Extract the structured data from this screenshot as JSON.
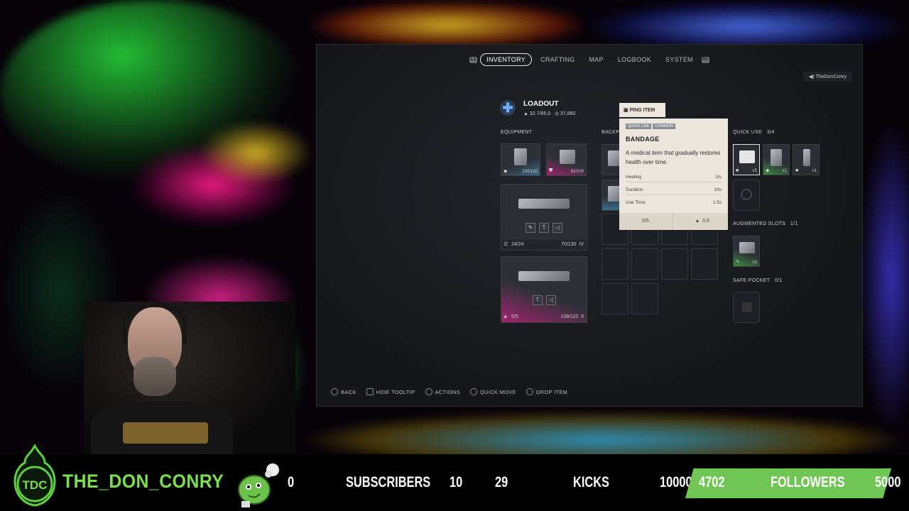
{
  "game": {
    "nav": {
      "left_button": "L1",
      "tabs": [
        "INVENTORY",
        "CRAFTING",
        "MAP",
        "LOGBOOK",
        "SYSTEM"
      ],
      "active_tab": "INVENTORY",
      "right_button": "R1"
    },
    "user_tag": "TheDonConry",
    "loadout": {
      "title": "LOADOUT",
      "weight": "32.7/65.0",
      "currency": "37,860"
    },
    "sections": {
      "equipment": "EQUIPMENT",
      "backpack": "BACKPA",
      "quick_use": "QUICK USE",
      "quick_use_count": "3/4",
      "augmented": "AUGMENTED SLOTS",
      "augmented_count": "1/1",
      "safe_pocket": "SAFE POCKET",
      "safe_pocket_count": "0/1"
    },
    "equipment": [
      {
        "count": "100/100"
      },
      {
        "count": "92/100"
      }
    ],
    "weapons": [
      {
        "ammo": "24/24",
        "reserve": "70/130",
        "tier": "IV"
      },
      {
        "ammo": "5/5",
        "reserve": "108/110",
        "tier": "II"
      }
    ],
    "quick_use_items": [
      {
        "count": "x5"
      },
      {
        "count": "x1"
      },
      {
        "count": "x1"
      }
    ],
    "augmented_item": {
      "count": "x3"
    },
    "tooltip": {
      "header": "PING ITEM",
      "header_button": "R3",
      "tags": [
        "QUICK USE",
        "COMMON"
      ],
      "title": "BANDAGE",
      "description": "A medical item that gradually restores health over time.",
      "stats": [
        {
          "label": "Healing",
          "value": "2/s"
        },
        {
          "label": "Duration",
          "value": "10s"
        },
        {
          "label": "Use Time",
          "value": "1.5s"
        }
      ],
      "stack": "5/5",
      "weight": "0.5"
    },
    "hints": [
      "BACK",
      "HIDE TOOLTIP",
      "ACTIONS",
      "QUICK MOVE",
      "DROP ITEM"
    ]
  },
  "overlay": {
    "logo_text": "TDC",
    "channel_name": "THE_DON_CONRY",
    "sub_current": "0",
    "subscribers_label": "SUBSCRIBERS",
    "sub_goal": "10",
    "kicks_current": "29",
    "kicks_label": "KICKS",
    "kicks_goal": "10000",
    "followers_current": "4702",
    "followers_label": "FOLLOWERS",
    "followers_goal": "5000"
  },
  "colors": {
    "accent_green": "#70c655",
    "channel_green": "#7be04a",
    "rarity_pink": "#a3246f",
    "rarity_blue": "#3b6e8a",
    "tooltip_bg": "#ece6dc"
  }
}
